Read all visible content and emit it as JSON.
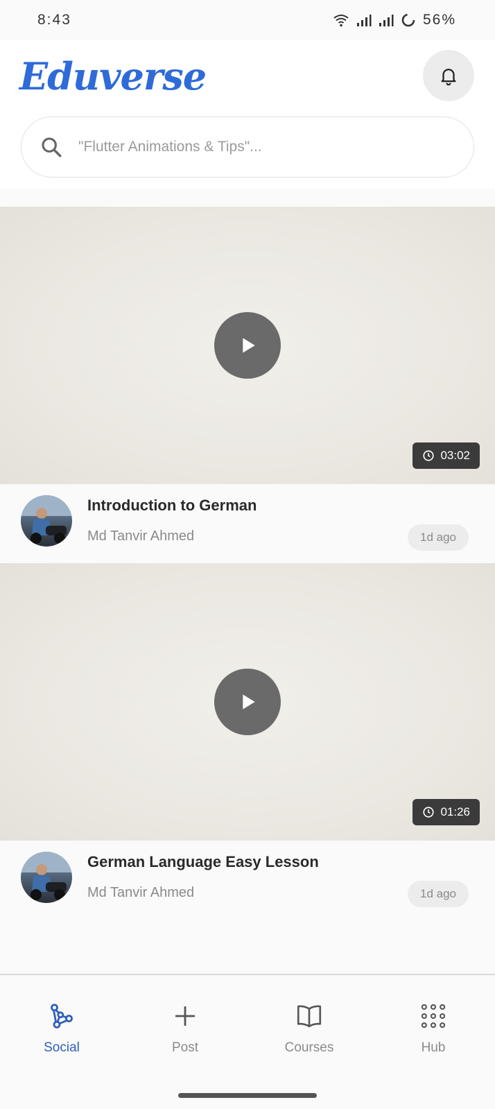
{
  "status": {
    "time": "8:43",
    "battery": "56%"
  },
  "header": {
    "logo": "Eduverse",
    "notification_icon": "bell-icon"
  },
  "search": {
    "placeholder": "\"Flutter Animations & Tips\"..."
  },
  "videos": [
    {
      "title": "Introduction to German",
      "author": "Md Tanvir Ahmed",
      "ago": "1d ago",
      "duration": "03:02"
    },
    {
      "title": "German Language Easy Lesson",
      "author": "Md Tanvir Ahmed",
      "ago": "1d ago",
      "duration": "01:26"
    }
  ],
  "nav": [
    {
      "label": "Social",
      "icon": "social-network-icon",
      "active": true
    },
    {
      "label": "Post",
      "icon": "plus-icon",
      "active": false
    },
    {
      "label": "Courses",
      "icon": "book-icon",
      "active": false
    },
    {
      "label": "Hub",
      "icon": "grid-dots-icon",
      "active": false
    }
  ],
  "colors": {
    "accent": "#2f6bd8",
    "nav_active": "#2f5fb8",
    "badge_bg": "#3b3b3b"
  }
}
